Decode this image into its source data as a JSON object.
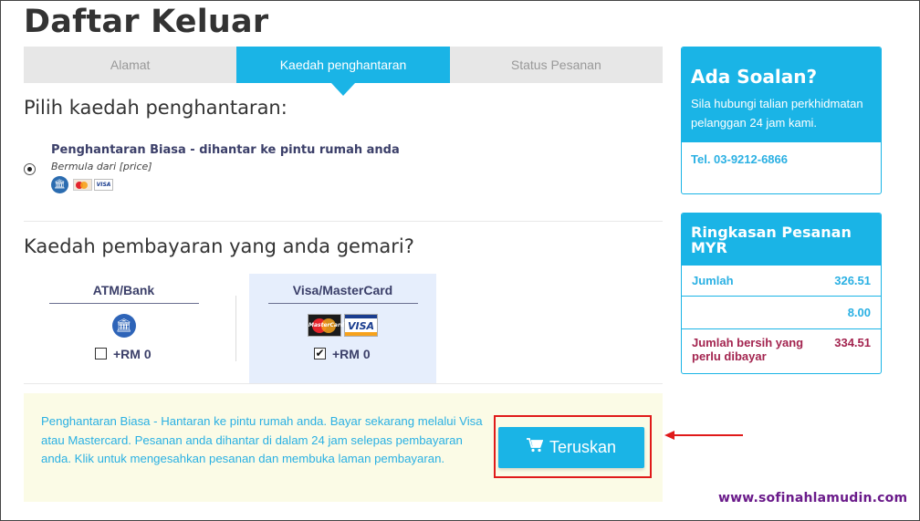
{
  "page": {
    "title": "Daftar Keluar"
  },
  "steps": [
    {
      "label": "Alamat"
    },
    {
      "label": "Kaedah penghantaran"
    },
    {
      "label": "Status Pesanan"
    }
  ],
  "delivery": {
    "heading": "Pilih kaedah penghantaran:",
    "option": {
      "title": "Penghantaran Biasa - dihantar ke pintu rumah anda",
      "subtitle": "Bermula dari [price]",
      "card_text": "VISA"
    }
  },
  "payment": {
    "heading": "Kaedah pembayaran yang anda gemari?",
    "methods": [
      {
        "name": "ATM/Bank",
        "fee": "+RM 0",
        "checked": false
      },
      {
        "name": "Visa/MasterCard",
        "fee": "+RM 0",
        "checked": true,
        "mc_text": "MasterCard",
        "visa_text": "VISA"
      }
    ]
  },
  "summary": {
    "text": "Penghantaran Biasa - Hantaran ke pintu rumah anda. Bayar sekarang melalui Visa atau Mastercard. Pesanan anda dihantar di dalam 24 jam selepas pembayaran anda. Klik untuk mengesahkan pesanan dan membuka laman pembayaran.",
    "button_label": "Teruskan"
  },
  "help": {
    "title": "Ada Soalan?",
    "body": "Sila hubungi talian perkhidmatan pelanggan 24 jam kami.",
    "tel": "Tel. 03-9212-6866"
  },
  "order_summary": {
    "title": "Ringkasan Pesanan MYR",
    "rows": [
      {
        "label": "Jumlah",
        "value": "326.51"
      },
      {
        "label": "",
        "value": "8.00"
      },
      {
        "label": "Jumlah bersih yang perlu dibayar",
        "value": "334.51"
      }
    ]
  },
  "watermark": "www.sofinahlamudin.com",
  "colors": {
    "accent": "#1ab4e6",
    "highlight": "#e01a1a",
    "total": "#a3244f"
  }
}
